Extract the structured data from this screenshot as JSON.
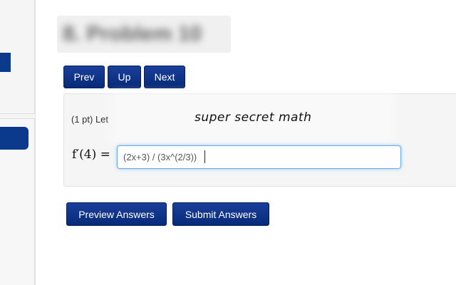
{
  "problem": {
    "title": "8. Problem 10",
    "points_prefix": "(1 pt) Let",
    "redacted_text": "super secret math",
    "math_label": "f′(4) ="
  },
  "nav": {
    "prev_label": "Prev",
    "up_label": "Up",
    "next_label": "Next"
  },
  "answer": {
    "value": "(2x+3) / (3x^(2/3))"
  },
  "actions": {
    "preview_label": "Preview Answers",
    "submit_label": "Submit Answers"
  },
  "colors": {
    "button": "#0b3a8c",
    "input_focus": "#66aee9"
  }
}
